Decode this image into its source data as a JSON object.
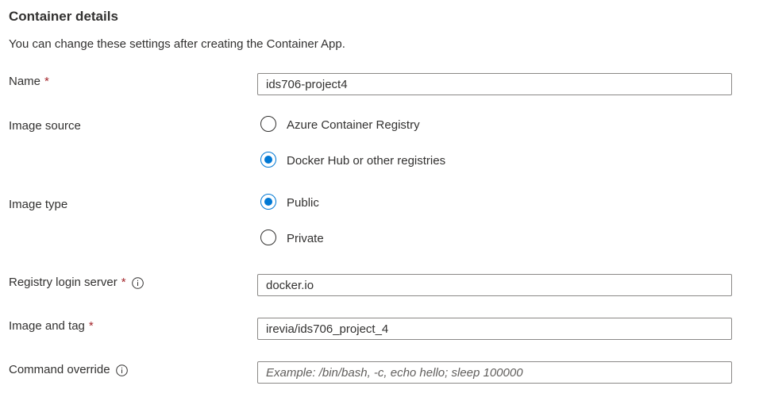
{
  "section": {
    "title": "Container details",
    "description": "You can change these settings after creating the Container App."
  },
  "fields": {
    "name": {
      "label": "Name",
      "required_mark": "*",
      "value": "ids706-project4"
    },
    "image_source": {
      "label": "Image source",
      "options": [
        {
          "label": "Azure Container Registry",
          "checked": false
        },
        {
          "label": "Docker Hub or other registries",
          "checked": true
        }
      ]
    },
    "image_type": {
      "label": "Image type",
      "options": [
        {
          "label": "Public",
          "checked": true
        },
        {
          "label": "Private",
          "checked": false
        }
      ]
    },
    "registry_login_server": {
      "label": "Registry login server",
      "required_mark": "*",
      "value": "docker.io",
      "icon": "info-icon"
    },
    "image_and_tag": {
      "label": "Image and tag",
      "required_mark": "*",
      "value": "irevia/ids706_project_4"
    },
    "command_override": {
      "label": "Command override",
      "value": "",
      "placeholder": "Example: /bin/bash, -c, echo hello; sleep 100000",
      "icon": "info-icon"
    }
  },
  "colors": {
    "accent": "#0078d4",
    "required": "#a4262c",
    "text": "#323130",
    "border": "#8a8886"
  }
}
